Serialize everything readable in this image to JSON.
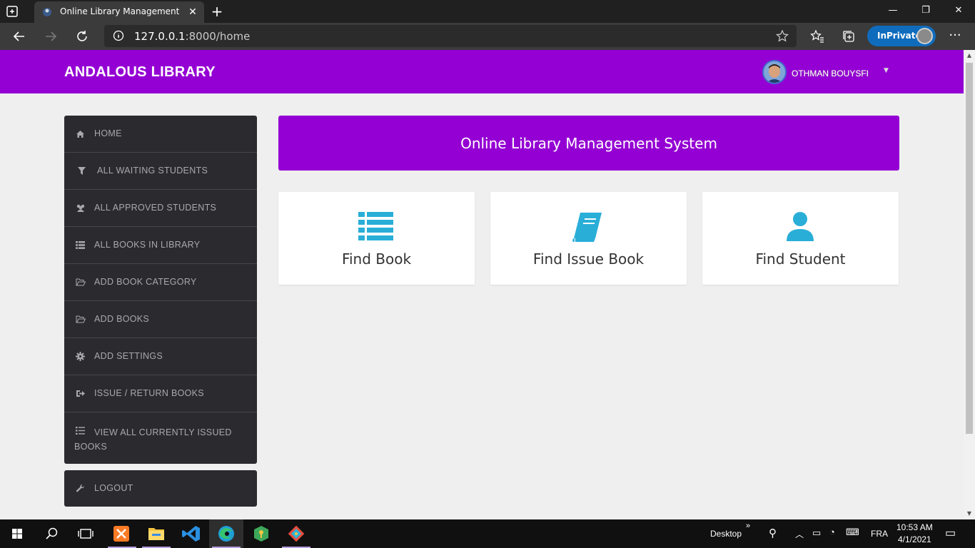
{
  "browser": {
    "tab_title": "Online Library Management Syst",
    "url_host": "127.0.0.1",
    "url_rest": ":8000/home",
    "inprivate_label": "InPrivate"
  },
  "header": {
    "brand": "ANDALOUS LIBRARY",
    "user_name": "OTHMAN BOUYSFI"
  },
  "sidebar": {
    "items": [
      {
        "label": "HOME",
        "icon": "home-icon"
      },
      {
        "label": "ALL WAITING STUDENTS",
        "icon": "filter-icon"
      },
      {
        "label": "ALL APPROVED STUDENTS",
        "icon": "users-icon"
      },
      {
        "label": "ALL BOOKS IN LIBRARY",
        "icon": "list-icon"
      },
      {
        "label": "ADD BOOK CATEGORY",
        "icon": "folder-open-icon"
      },
      {
        "label": "ADD BOOKS",
        "icon": "folder-open-icon"
      },
      {
        "label": "ADD SETTINGS",
        "icon": "gear-icon"
      },
      {
        "label": "ISSUE / RETURN BOOKS",
        "icon": "sign-out-icon"
      },
      {
        "label": "VIEW ALL CURRENTLY ISSUED BOOKS",
        "icon": "list-icon"
      }
    ],
    "logout": "LOGOUT"
  },
  "main": {
    "banner_title": "Online Library Management System",
    "cards": [
      {
        "label": "Find Book",
        "icon": "list-icon"
      },
      {
        "label": "Find Issue Book",
        "icon": "book-icon"
      },
      {
        "label": "Find Student",
        "icon": "user-icon"
      }
    ]
  },
  "taskbar": {
    "desktop_label": "Desktop",
    "language": "FRA",
    "time": "10:53 AM",
    "date": "4/1/2021"
  },
  "colors": {
    "accent": "#9400d3",
    "sidebar_bg": "#2b2b2f",
    "card_icon": "#29aed8"
  }
}
